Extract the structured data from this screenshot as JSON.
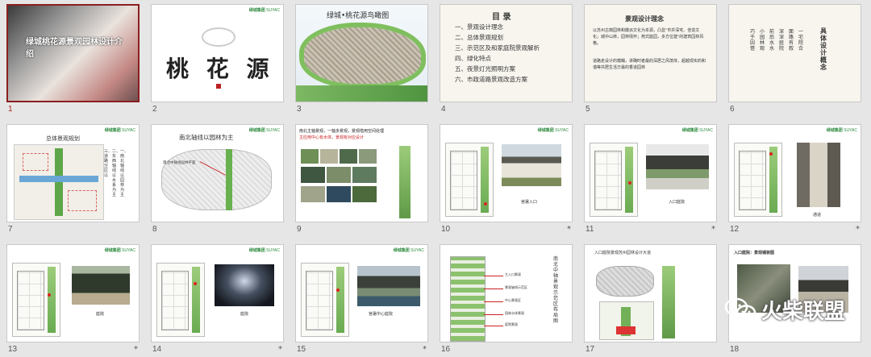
{
  "watermark": {
    "text": "火柴联盟",
    "icon": "wechat-icon"
  },
  "brand": {
    "logo_text": "绿城集团",
    "partner_text": "SUYAC"
  },
  "slides": [
    {
      "number": "1",
      "title": "绿城桃花源景观园林设计介绍",
      "selected": true,
      "star": false
    },
    {
      "number": "2",
      "title": "桃 花 源",
      "star": false
    },
    {
      "number": "3",
      "title": "绿城•桃花源鸟瞰图",
      "star": false
    },
    {
      "number": "4",
      "title": "目  录",
      "items": [
        "一、景观设计理念",
        "二、总体景观规划",
        "三、示范区及和家庭院景观解析",
        "四、绿化特点",
        "五、夜景灯光照明方案",
        "六、市政道路景观改造方案"
      ],
      "star": false
    },
    {
      "number": "5",
      "title": "景观设计理念",
      "bullets": [
        "以苏州古典园林和徽派文化为本源，凸显\"市井深宅、佳造文化；城中山林，园林情怀；苑式庭园，多方位建\"的建筑园林风格。",
        "道路走设计的模糊，讲确时者最的深居之风境体，超越现实的和谐等共居生活方最的香道园林"
      ],
      "star": false
    },
    {
      "number": "6",
      "title": "具体设计概念",
      "cols": [
        "一宅院合",
        "面路有叙",
        "深深庭院",
        "前后水水",
        "小园林观",
        "巧于因借"
      ],
      "star": false
    },
    {
      "number": "7",
      "title": "总体景观规划",
      "side": [
        "一、南北轴线以园林为主",
        "二、东西轴线以水系为主",
        "三、道路分区以"
      ],
      "star": false
    },
    {
      "number": "8",
      "title": "南北轴线以园林为主",
      "caption": "南北中轴线园林平面",
      "star": false
    },
    {
      "number": "9",
      "title": "南北主轴景观，一轴多景观，景观借用空间处理",
      "subtitle": "主应用中心有水体，景观有对应设计",
      "star": false
    },
    {
      "number": "10",
      "caption": "宫署入口",
      "star": true
    },
    {
      "number": "11",
      "caption": "入口庭院",
      "star": true
    },
    {
      "number": "12",
      "caption": "通道",
      "star": true
    },
    {
      "number": "13",
      "caption": "庭院",
      "star": true
    },
    {
      "number": "14",
      "caption": "庭院",
      "star": true
    },
    {
      "number": "15",
      "caption": "宫署中心庭院",
      "star": true
    },
    {
      "number": "16",
      "vertical": "南北中轴景观示范区布局图",
      "labels": [
        "主入口景观",
        "景观轴线示范区",
        "中心景观区",
        "园林水体景观",
        "庭院景观"
      ],
      "star": false
    },
    {
      "number": "17",
      "title": "入口庭院景观苏州园林设计大道",
      "star": false
    },
    {
      "number": "18",
      "title": "入口庭院：景观铺装图",
      "star": false
    }
  ],
  "colors": {
    "selection": "#8a1f1f",
    "brand_green": "#2d8a3e",
    "slide_bg": "#e6e6e6"
  }
}
